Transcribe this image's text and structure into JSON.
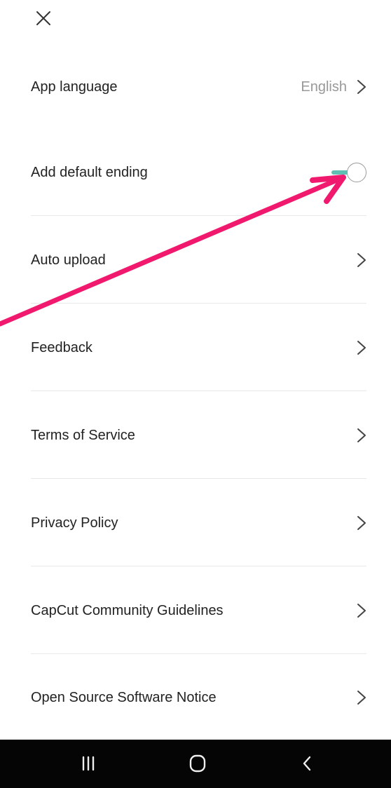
{
  "header": {
    "close_icon": "close-icon"
  },
  "settings": [
    {
      "label": "App language",
      "value": "English",
      "control": "chevron"
    },
    {
      "label": "Add default ending",
      "control": "toggle",
      "toggle_on": true
    },
    {
      "label": "Auto upload",
      "control": "chevron"
    },
    {
      "label": "Feedback",
      "control": "chevron"
    },
    {
      "label": "Terms of Service",
      "control": "chevron"
    },
    {
      "label": "Privacy Policy",
      "control": "chevron"
    },
    {
      "label": "CapCut Community Guidelines",
      "control": "chevron"
    },
    {
      "label": "Open Source Software Notice",
      "control": "chevron"
    }
  ],
  "colors": {
    "toggle_accent": "#5fbfb3",
    "annotation_arrow": "#f0196e",
    "nav_bar": "#050505"
  },
  "nav_bar": {
    "icons": [
      "recent-apps-icon",
      "home-icon",
      "back-icon"
    ]
  }
}
